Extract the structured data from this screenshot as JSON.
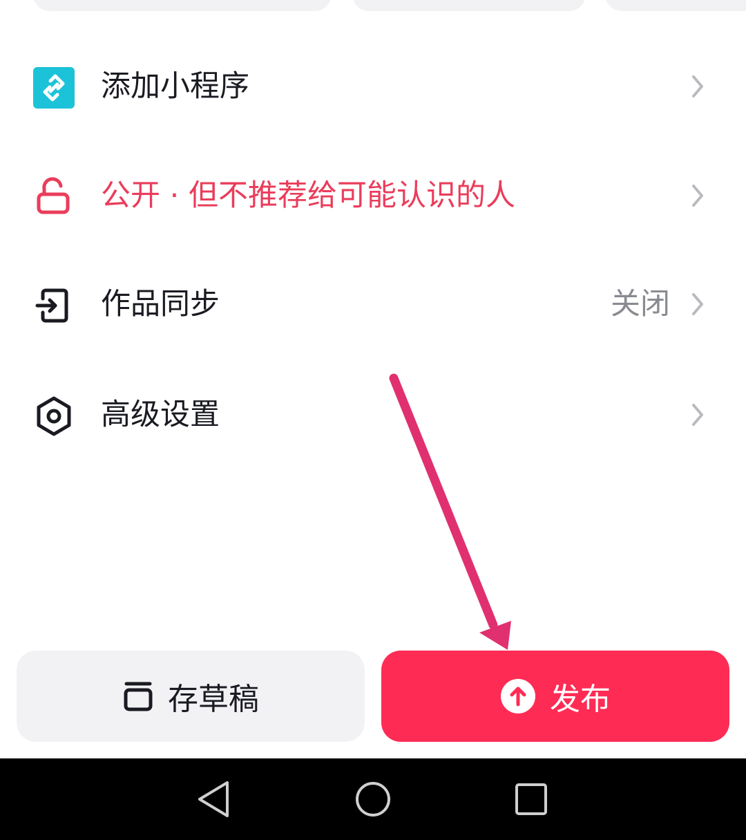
{
  "menu": {
    "mini_program": {
      "label": "添加小程序",
      "icon": "mini-program-icon"
    },
    "visibility": {
      "label": "公开 · 但不推荐给可能认识的人",
      "icon": "unlock-icon",
      "color": "#ea3d5b"
    },
    "sync": {
      "label": "作品同步",
      "value": "关闭",
      "icon": "sync-exit-icon"
    },
    "advanced": {
      "label": "高级设置",
      "icon": "settings-hexagon-icon"
    }
  },
  "actions": {
    "draft": {
      "label": "存草稿",
      "icon": "draft-box-icon"
    },
    "publish": {
      "label": "发布",
      "icon": "upload-arrow-icon",
      "color": "#fe2c55"
    }
  },
  "system_nav": {
    "back": "back-triangle-icon",
    "home": "home-circle-icon",
    "recents": "recents-square-icon"
  },
  "colors": {
    "accent": "#fe2c55",
    "annotation_arrow": "#e0306f",
    "mini_program_icon_bg": "#1cc2d8"
  }
}
